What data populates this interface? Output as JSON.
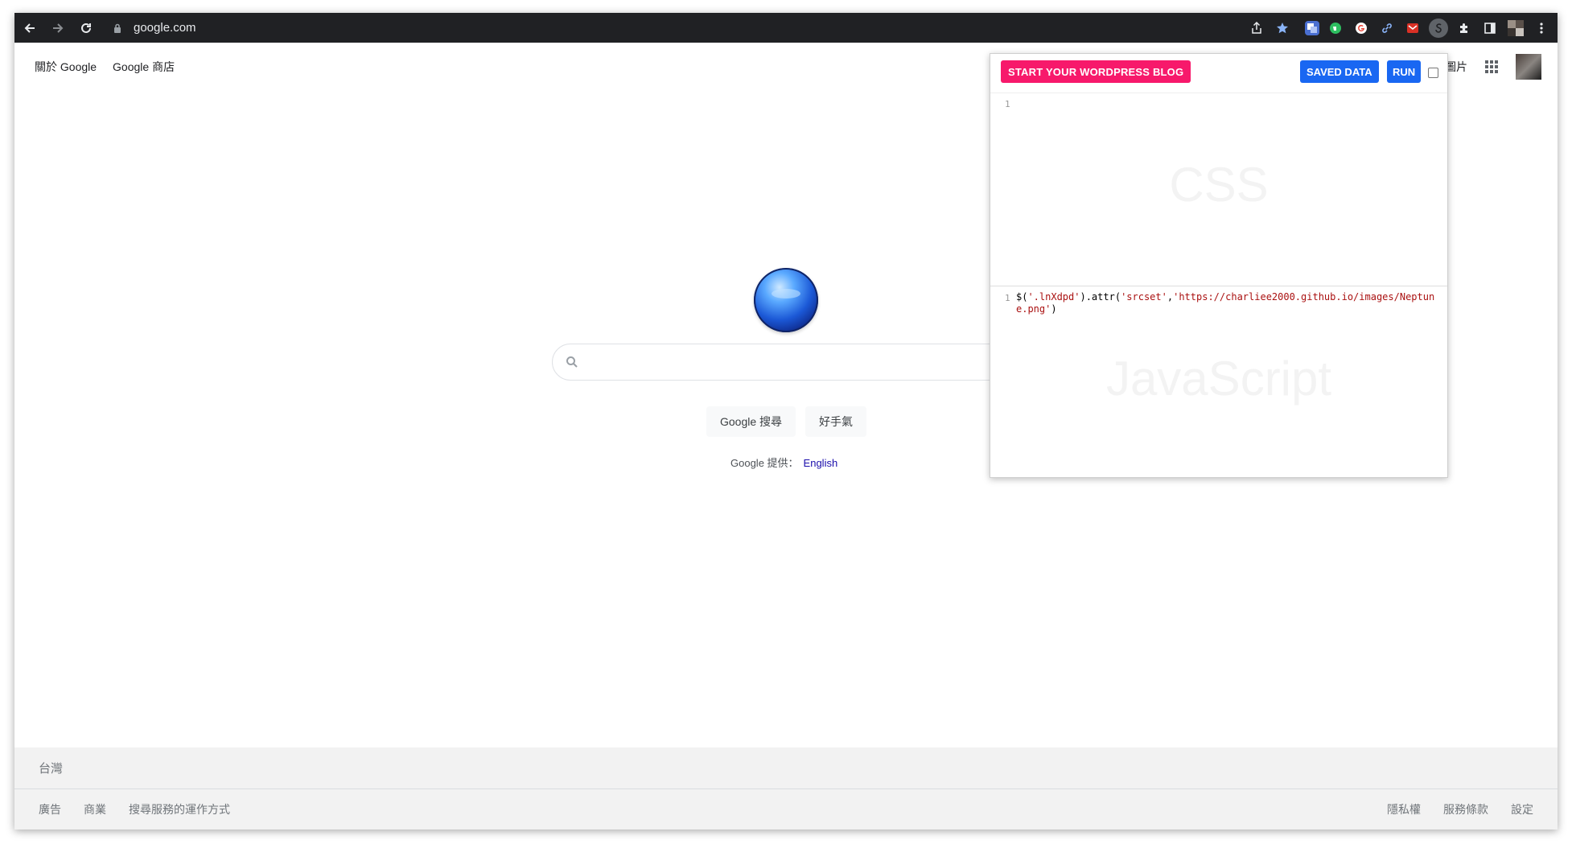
{
  "browser": {
    "url": "google.com"
  },
  "page": {
    "top_links": [
      "關於 Google",
      "Google 商店"
    ],
    "top_right_text": "圖片",
    "search_placeholder": "",
    "buttons": {
      "search": "Google 搜尋",
      "lucky": "好手氣"
    },
    "language": {
      "label": "Google 提供：",
      "link": "English"
    },
    "footer": {
      "country": "台灣",
      "left_links": [
        "廣告",
        "商業",
        "搜尋服務的運作方式"
      ],
      "right_links": [
        "隱私權",
        "服務條款",
        "設定"
      ]
    }
  },
  "popup": {
    "wp_button": "START YOUR WORDPRESS BLOG",
    "saved_button": "SAVED DATA",
    "run_button": "RUN",
    "css": {
      "line_number": "1",
      "watermark": "CSS"
    },
    "js": {
      "line_number": "1",
      "watermark": "JavaScript",
      "code_prefix": "$(",
      "code_selector": "'.lnXdpd'",
      "code_mid": ").attr(",
      "code_attr": "'srcset'",
      "code_comma": ",",
      "code_url": "'https://charliee2000.github.io/images/Neptune.png'",
      "code_suffix": ")"
    }
  },
  "colors": {
    "wp_button": "#f7196b",
    "popup_button": "#1967f2",
    "toolbar": "#202124"
  }
}
